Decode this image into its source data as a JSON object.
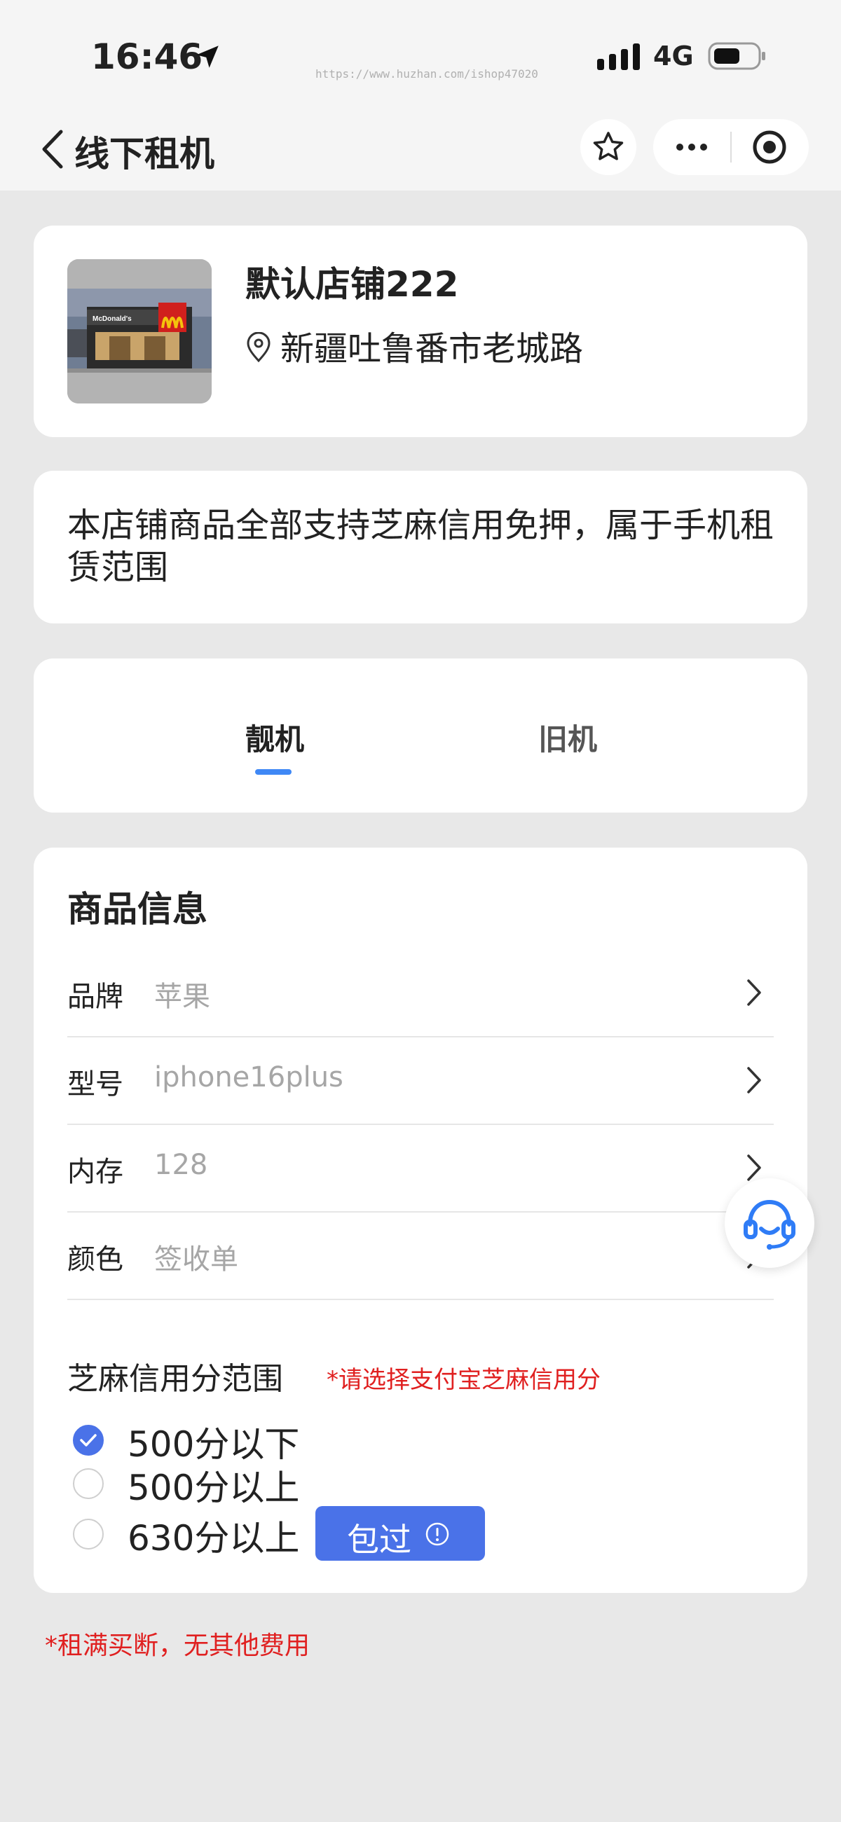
{
  "status_bar": {
    "time": "16:46",
    "network": "4G",
    "watermark": "https://www.huzhan.com/ishop47020"
  },
  "nav": {
    "title": "线下租机"
  },
  "store": {
    "name": "默认店铺222",
    "address": "新疆吐鲁番市老城路",
    "image_text": "McDonald's"
  },
  "notice": "本店铺商品全部支持芝麻信用免押，属于手机租赁范围",
  "tabs": [
    {
      "label": "靓机",
      "active": true
    },
    {
      "label": "旧机",
      "active": false
    }
  ],
  "product_info": {
    "title": "商品信息",
    "rows": [
      {
        "label": "品牌",
        "value": "苹果"
      },
      {
        "label": "型号",
        "value": "iphone16plus"
      },
      {
        "label": "内存",
        "value": "128"
      },
      {
        "label": "颜色",
        "value": "签收单"
      }
    ],
    "credit": {
      "label": "芝麻信用分范围",
      "hint": "*请选择支付宝芝麻信用分",
      "options": [
        {
          "label": "500分以下",
          "checked": true
        },
        {
          "label": "500分以上",
          "checked": false
        },
        {
          "label": "630分以上",
          "checked": false
        }
      ],
      "badge": "包过"
    }
  },
  "footnote": "*租满买断，无其他费用",
  "colors": {
    "accent": "#4a72e8",
    "tab_underline": "#3f88f5",
    "warning": "#e02020",
    "service_icon": "#2f7cf6"
  },
  "icons": [
    "location-arrow-icon",
    "signal-icon",
    "battery-icon",
    "back-icon",
    "star-icon",
    "more-icon",
    "target-icon",
    "pin-icon",
    "chevron-right-icon",
    "checkmark-icon",
    "info-icon",
    "headset-icon"
  ]
}
